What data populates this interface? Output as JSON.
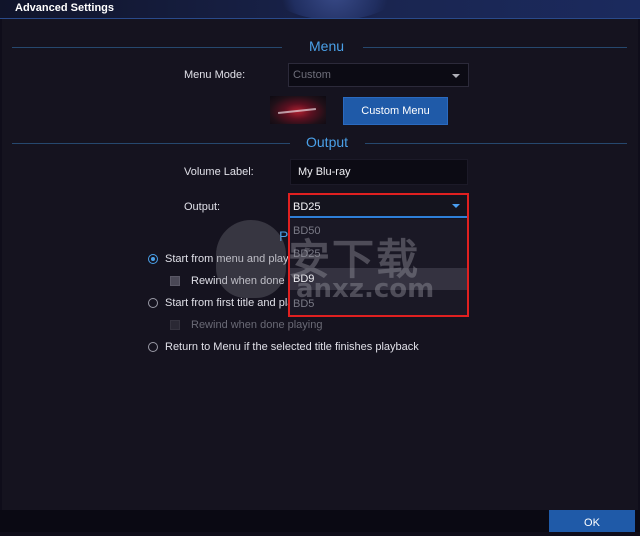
{
  "window": {
    "title": "Advanced Settings"
  },
  "menu_section": {
    "heading": "Menu",
    "menu_mode_label": "Menu Mode:",
    "menu_mode_value": "Custom",
    "custom_menu_button": "Custom Menu"
  },
  "output_section": {
    "heading": "Output",
    "volume_label_label": "Volume Label:",
    "volume_label_value": "My Blu-ray",
    "output_label": "Output:",
    "output_value": "BD25",
    "output_options": [
      "BD50",
      "BD25",
      "BD9",
      "BD5"
    ],
    "hovered_option": "BD9"
  },
  "playback_section": {
    "heading_partial": "Pl",
    "options": [
      {
        "label": "Start from menu and play",
        "selected": true
      },
      {
        "label": "Rewind when done playing",
        "checked": false
      },
      {
        "label": "Start from first title and play",
        "selected": false
      },
      {
        "label": "Rewind when done playing",
        "checked": false,
        "disabled": true
      },
      {
        "label": "Return to Menu if the selected title finishes playback",
        "selected": false
      }
    ]
  },
  "watermark": {
    "text": "安下载",
    "url": "anxz.com"
  },
  "footer": {
    "ok_button": "OK"
  },
  "colors": {
    "accent": "#4aa0e8",
    "button": "#1f5aa8",
    "highlight": "#e02020",
    "background": "#15131f"
  }
}
